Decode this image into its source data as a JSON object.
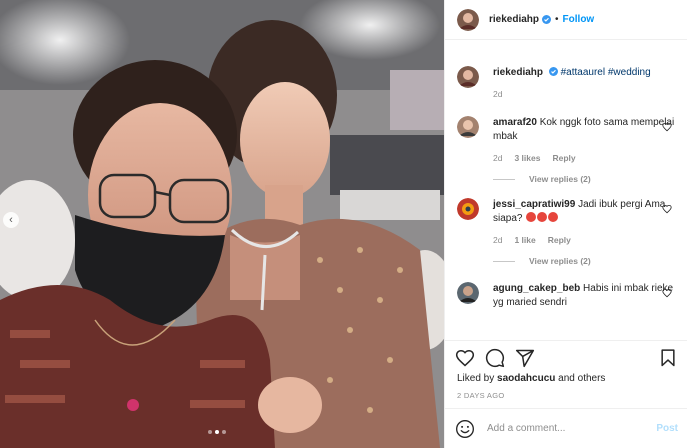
{
  "post": {
    "author": "riekediahp",
    "follow_label": "Follow",
    "separator": "•",
    "caption_tags": "#attaaurel #wedding",
    "caption_age": "2d",
    "likes_prefix": "Liked by",
    "liked_by": "saodahcucu",
    "likes_suffix": "and others",
    "date": "2 DAYS AGO"
  },
  "comments": [
    {
      "user": "amaraf20",
      "text": "Kok nggk foto sama mempelai mbak",
      "age": "2d",
      "likes": "3 likes",
      "reply": "Reply",
      "view_replies": "View replies (2)"
    },
    {
      "user": "jessi_capratiwi99",
      "text": "Jadi ibuk pergi Ama siapa?",
      "age": "2d",
      "likes": "1 like",
      "reply": "Reply",
      "view_replies": "View replies (2)"
    },
    {
      "user": "agung_cakep_beb",
      "text": "Habis ini mbak rieke yg maried sendri"
    }
  ],
  "add_comment": {
    "placeholder": "Add a comment...",
    "post_label": "Post"
  },
  "colors": {
    "accent": "#0095f6",
    "tag": "#00376b",
    "secondary_text": "#8e8e8e"
  }
}
